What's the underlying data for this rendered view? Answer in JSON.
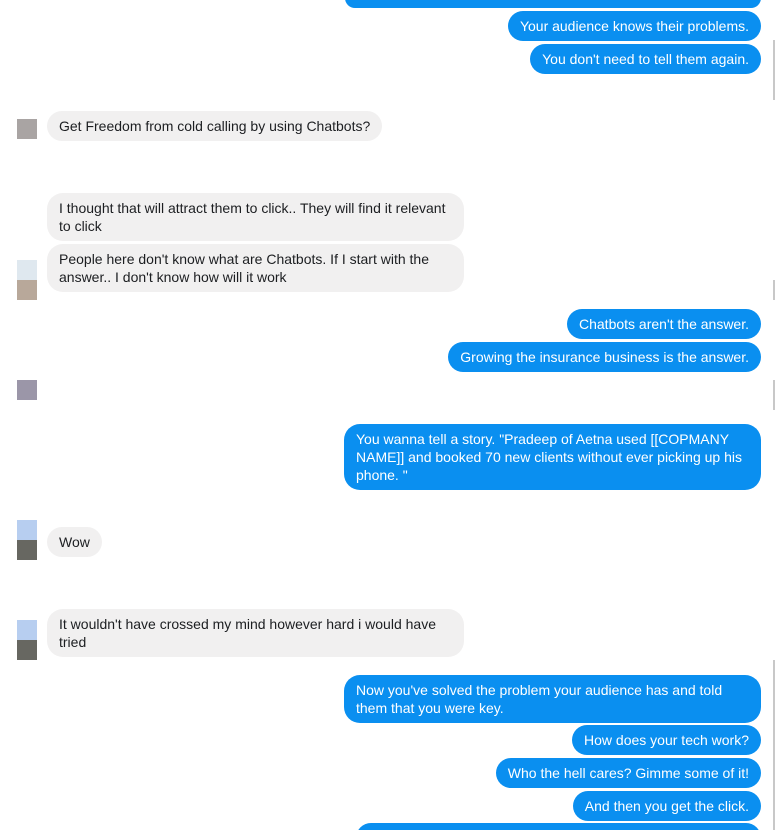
{
  "colors": {
    "outgoing_bubble": "#0a8ff0",
    "incoming_bubble": "#f1f0f0",
    "incoming_text": "#1c1e21"
  },
  "messages": [
    {
      "from": "me",
      "text": "Your audience knows their problems."
    },
    {
      "from": "me",
      "text": "You don't need to tell them again."
    },
    {
      "from": "them",
      "text": "Get Freedom from cold calling by using Chatbots?"
    },
    {
      "from": "them",
      "text": "I thought that will attract them to click.. They will find it relevant to click"
    },
    {
      "from": "them",
      "text": "People here don't know what are Chatbots. If I start with the answer.. I don't know how will it work"
    },
    {
      "from": "me",
      "text": "Chatbots aren't the answer."
    },
    {
      "from": "me",
      "text": "Growing the insurance business is the answer."
    },
    {
      "from": "me",
      "text": "You wanna tell a story. \"Pradeep of Aetna used [[COPMANY NAME]] and booked 70 new clients without ever picking up his phone. \""
    },
    {
      "from": "them",
      "text": "Wow"
    },
    {
      "from": "them",
      "text": "It wouldn't have crossed my mind however hard i would have tried"
    },
    {
      "from": "me",
      "text": "Now you've solved the problem your audience has and told them that you were key."
    },
    {
      "from": "me",
      "text": "How does your tech work?"
    },
    {
      "from": "me",
      "text": "Who the hell cares? Gimme some of it!"
    },
    {
      "from": "me",
      "text": "And then you get the click."
    }
  ]
}
